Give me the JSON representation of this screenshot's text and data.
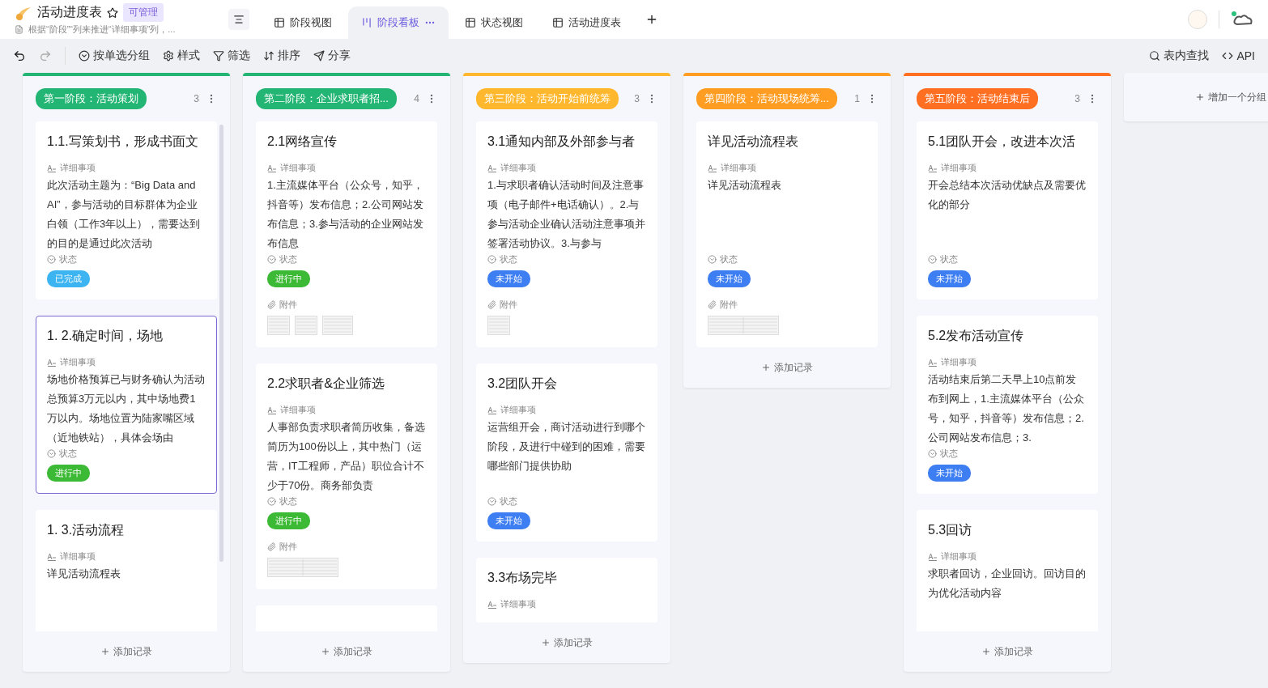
{
  "header": {
    "title": "活动进度表",
    "badge": "可管理",
    "subtitle": "根据“阶段”“列来推进“详细事项”列，...",
    "views": [
      {
        "label": "阶段视图",
        "kind": "grid",
        "selected": false
      },
      {
        "label": "阶段看板",
        "kind": "kanban",
        "selected": true
      },
      {
        "label": "状态视图",
        "kind": "grid",
        "selected": false
      },
      {
        "label": "活动进度表",
        "kind": "grid",
        "selected": false
      }
    ]
  },
  "toolbar": {
    "left": [
      {
        "label": "按单选分组",
        "kind": "group"
      },
      {
        "label": "样式",
        "kind": "style"
      },
      {
        "label": "筛选",
        "kind": "filter"
      },
      {
        "label": "排序",
        "kind": "sort"
      },
      {
        "label": "分享",
        "kind": "share"
      }
    ],
    "right": [
      {
        "label": "表内查找",
        "kind": "search"
      },
      {
        "label": "API",
        "kind": "api"
      }
    ]
  },
  "columns": [
    {
      "title": "第一阶段：活动策划",
      "count": "3",
      "color": "#22b573",
      "add_label": "添加记录",
      "scrollbar": true,
      "cards": [
        {
          "kind": "full",
          "selected": false,
          "title": "1.1.写策划书，形成书面文",
          "detail_label": "详细事项",
          "detail": "此次活动主题为：“Big Data and AI”，参与活动的目标群体为企业白领（工作3年以上），需要达到的目的是通过此次活动",
          "status_label": "状态",
          "status": {
            "label": "已完成",
            "color": "#3cb4f2"
          }
        },
        {
          "kind": "full",
          "selected": true,
          "title": "1. 2.确定时间，场地",
          "detail_label": "详细事项",
          "detail": "场地价格预算已与财务确认为活动总预算3万元以内，其中场地费1万以内。场地位置为陆家嘴区域（近地铁站），具体会场由",
          "status_label": "状态",
          "status": {
            "label": "进行中",
            "color": "#3dba35"
          }
        },
        {
          "kind": "full",
          "selected": false,
          "title": "1. 3.活动流程",
          "detail_label": "详细事项",
          "detail": "详见活动流程表"
        }
      ]
    },
    {
      "title": "第二阶段：企业求职者招...",
      "count": "4",
      "color": "#22b573",
      "add_label": "添加记录",
      "scrollbar": false,
      "cards": [
        {
          "kind": "full",
          "selected": false,
          "title": "2.1网络宣传",
          "detail_label": "详细事项",
          "detail": "1.主流媒体平台（公众号，知乎，抖音等）发布信息；2.公司网站发布信息；3.参与活动的企业网站发布信息",
          "status_label": "状态",
          "status": {
            "label": "进行中",
            "color": "#3dba35"
          },
          "attachments_label": "附件",
          "attachments": [
            {
              "kind": "sheet"
            },
            {
              "kind": "sheet"
            },
            {
              "kind": "wide"
            }
          ]
        },
        {
          "kind": "full",
          "selected": false,
          "title": "2.2求职者&企业筛选",
          "detail_label": "详细事项",
          "detail": "人事部负责求职者简历收集，备选简历为100份以上，其中热门（运营，IT工程师，产品）职位合计不少于70份。商务部负责",
          "status_label": "状态",
          "status": {
            "label": "进行中",
            "color": "#3dba35"
          },
          "attachments_label": "附件",
          "attachments": [
            {
              "kind": "table"
            }
          ]
        },
        {
          "kind": "partial",
          "selected": false
        }
      ]
    },
    {
      "title": "第三阶段：活动开始前统筹",
      "count": "3",
      "color": "#ffb82e",
      "add_label": "添加记录",
      "scrollbar": false,
      "cards": [
        {
          "kind": "full",
          "selected": false,
          "title": "3.1通知内部及外部参与者",
          "detail_label": "详细事项",
          "detail": "1.与求职者确认活动时间及注意事项（电子邮件+电话确认）。2.与参与活动企业确认活动注意事项并签署活动协议。3.与参与",
          "status_label": "状态",
          "status": {
            "label": "未开始",
            "color": "#3d7ef2"
          },
          "attachments_label": "附件",
          "attachments": [
            {
              "kind": "sheet"
            }
          ]
        },
        {
          "kind": "full",
          "selected": false,
          "title": "3.2团队开会",
          "detail_label": "详细事项",
          "detail": "运营组开会，商讨活动进行到哪个阶段，及进行中碰到的困难，需要哪些部门提供协助",
          "status_label": "状态",
          "status": {
            "label": "未开始",
            "color": "#3d7ef2"
          }
        },
        {
          "kind": "full",
          "selected": false,
          "title": "3.3布场完毕",
          "detail_label": "详细事项"
        }
      ]
    },
    {
      "title": "第四阶段：活动现场统筹...",
      "count": "1",
      "color": "#ff9d22",
      "add_label": "添加记录",
      "scrollbar": false,
      "cards": [
        {
          "kind": "full",
          "selected": false,
          "title": "详见活动流程表",
          "detail_label": "详细事项",
          "detail": "详见活动流程表",
          "status_label": "状态",
          "status": {
            "label": "未开始",
            "color": "#3d7ef2"
          },
          "attachments_label": "附件",
          "attachments": [
            {
              "kind": "table"
            }
          ]
        }
      ]
    },
    {
      "title": "第五阶段：活动结束后",
      "count": "3",
      "color": "#ff6f22",
      "add_label": "添加记录",
      "scrollbar": false,
      "cards": [
        {
          "kind": "full",
          "selected": false,
          "title": "5.1团队开会，改进本次活",
          "detail_label": "详细事项",
          "detail": "开会总结本次活动优缺点及需要优化的部分",
          "status_label": "状态",
          "status": {
            "label": "未开始",
            "color": "#3d7ef2"
          }
        },
        {
          "kind": "full",
          "selected": false,
          "title": "5.2发布活动宣传",
          "detail_label": "详细事项",
          "detail": "活动结束后第二天早上10点前发布到网上，1.主流媒体平台（公众号，知乎，抖音等）发布信息；2.公司网站发布信息；3.",
          "status_label": "状态",
          "status": {
            "label": "未开始",
            "color": "#3d7ef2"
          }
        },
        {
          "kind": "full",
          "selected": false,
          "title": "5.3回访",
          "detail_label": "详细事项",
          "detail": "求职者回访，企业回访。回访目的为优化活动内容"
        }
      ]
    }
  ],
  "add_group": "增加一个分组"
}
